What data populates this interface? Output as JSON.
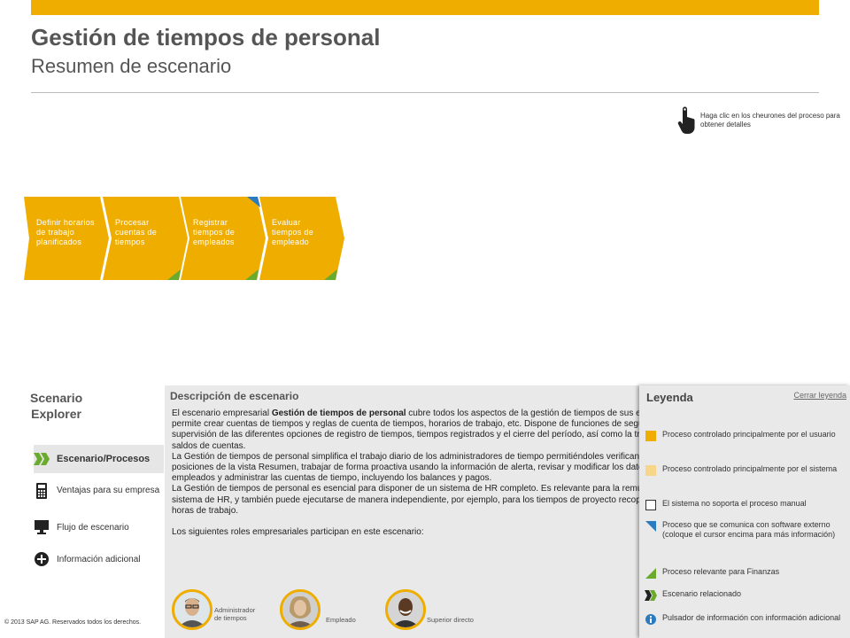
{
  "header": {
    "title": "Gestión de tiempos de personal",
    "subtitle": "Resumen de escenario"
  },
  "hint": {
    "text": "Haga clic en los cheurones del proceso para obtener detalles",
    "icon": "pointer-hand-icon"
  },
  "process": {
    "steps": [
      {
        "label": "Definir horarios de trabajo planificados"
      },
      {
        "label": "Procesar cuentas de tiempos"
      },
      {
        "label": "Registrar tiempos de empleados"
      },
      {
        "label": "Evaluar tiempos de empleado"
      }
    ]
  },
  "explorer": {
    "title_line1": "Scenario",
    "title_line2": "Explorer",
    "items": [
      {
        "label": "Escenario/Procesos",
        "icon": "double-chevron-icon"
      },
      {
        "label": "Ventajas para su empresa",
        "icon": "calculator-icon"
      },
      {
        "label": "Flujo de escenario",
        "icon": "monitor-icon"
      },
      {
        "label": "Información adicional",
        "icon": "plus-circle-icon"
      }
    ]
  },
  "description": {
    "title": "Descripción de escenario",
    "p1_prefix": "El escenario empresarial ",
    "p1_bold": "Gestión de tiempos de personal",
    "p1_rest": " cubre todos los aspectos de la gestión de tiempos de sus empleados. Le permite crear cuentas de tiempos y reglas de cuenta de tiempos, horarios de trabajo, etc. Dispone de funciones de seguimiento y supervisión de las diferentes opciones de registro de tiempos, tiempos registrados y el cierre del período, así como la transferencia de saldos de cuentas.",
    "p2": "La Gestión de tiempos de personal simplifica el trabajo diario de los administradores de tiempo permitiéndoles verificando alertas y posiciones de la vista Resumen, trabajar de forma proactiva usando la información de alerta, revisar y modificar los datos de tiempo de los empleados y administrar las cuentas de tiempo, incluyendo los balances y pagos.",
    "p3": "La Gestión de tiempos de personal es esencial para disponer de un sistema de HR completo. Es relevante para la remuneración en su sistema de HR, y también puede ejecutarse de manera independiente, por ejemplo, para los tiempos de proyecto recopilados en la hoja de horas de trabajo.",
    "p4": "Los siguientes roles empresariales participan en este escenario:",
    "roles": [
      {
        "label_line1": "Administrador",
        "label_line2": "de tiempos"
      },
      {
        "label_line1": "Empleado",
        "label_line2": ""
      },
      {
        "label_line1": "Superior directo",
        "label_line2": ""
      }
    ]
  },
  "legend": {
    "title": "Leyenda",
    "close": "Cerrar leyenda",
    "items": [
      {
        "label": "Proceso controlado principalmente por el usuario",
        "icon": "user-process-icon"
      },
      {
        "label": "Proceso controlado principalmente por el sistema",
        "icon": "system-process-icon"
      },
      {
        "label": "El sistema no soporta el proceso manual",
        "icon": "manual-process-icon"
      },
      {
        "label": "Proceso que se comunica con software externo (coloque el cursor encima para más información)",
        "icon": "external-software-icon"
      },
      {
        "label": "Proceso relevante para Finanzas",
        "icon": "finance-icon"
      },
      {
        "label": "Escenario relacionado",
        "icon": "related-scenario-icon"
      },
      {
        "label": "Pulsador de información con información adicional",
        "icon": "info-icon"
      }
    ]
  },
  "footer": {
    "copyright": "© 2013 SAP AG. Reservados todos los derechos."
  },
  "colors": {
    "accent": "#efad00",
    "green": "#6aab2e",
    "blue": "#2b7bc0",
    "panel": "#e9e9e9"
  }
}
